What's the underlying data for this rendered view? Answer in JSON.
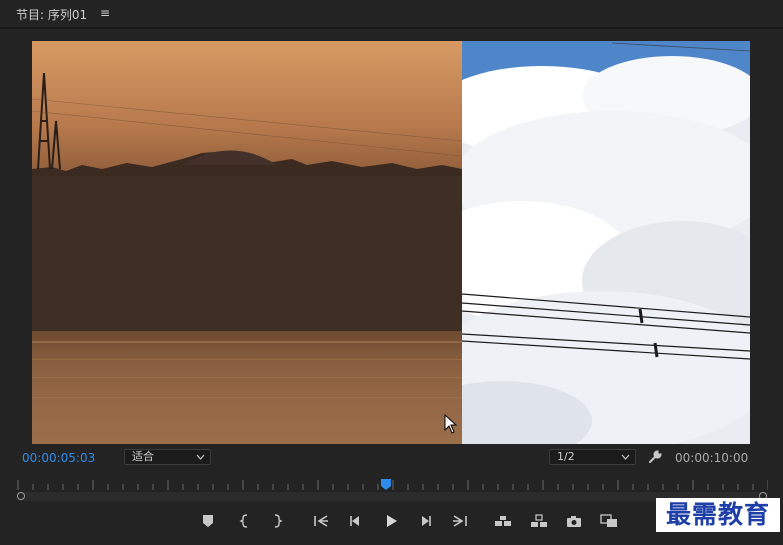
{
  "panel": {
    "title": "节目: 序列01",
    "menu_icon": "hamburger-menu-icon"
  },
  "viewer": {
    "left_scene": "sunset-lake-silhouette",
    "right_scene": "clouds-power-lines"
  },
  "controls": {
    "current_timecode": "00:00:05:03",
    "total_duration": "00:00:10:00",
    "zoom_select": "适合",
    "resolution_select": "1/2",
    "playhead_position": 0.5
  },
  "transport_buttons": [
    "add-marker-icon",
    "mark-in-icon",
    "mark-out-icon",
    "go-to-in-icon",
    "step-back-icon",
    "play-icon",
    "step-forward-icon",
    "go-to-out-icon",
    "lift-icon",
    "extract-icon",
    "export-frame-icon",
    "comparison-view-icon"
  ],
  "watermark": "最需教育",
  "colors": {
    "timecode_accent": "#2d8ceb",
    "panel_bg": "#232323",
    "playhead": "#2d8ceb"
  }
}
